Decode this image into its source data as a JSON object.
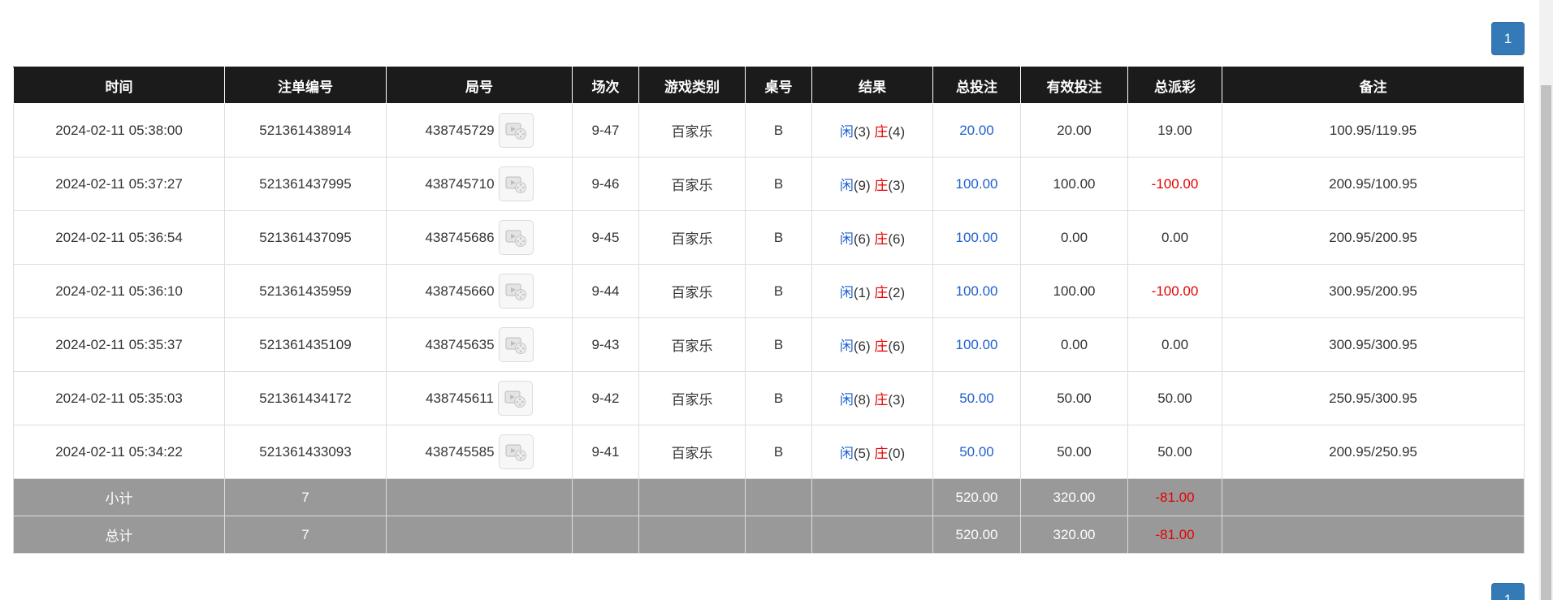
{
  "pagination": {
    "current_page": "1"
  },
  "table": {
    "headers": [
      "时间",
      "注单编号",
      "局号",
      "场次",
      "游戏类别",
      "桌号",
      "结果",
      "总投注",
      "有效投注",
      "总派彩",
      "备注"
    ],
    "rows": [
      {
        "time": "2024-02-11 05:38:00",
        "bet_id": "521361438914",
        "round": "438745729",
        "session": "9-47",
        "game": "百家乐",
        "table": "B",
        "result": {
          "player_label": "闲",
          "player_score": "(3)",
          "banker_label": "庄",
          "banker_score": "(4)"
        },
        "total_bet": "20.00",
        "valid_bet": "20.00",
        "payout": "19.00",
        "payout_negative": false,
        "note": "100.95/119.95"
      },
      {
        "time": "2024-02-11 05:37:27",
        "bet_id": "521361437995",
        "round": "438745710",
        "session": "9-46",
        "game": "百家乐",
        "table": "B",
        "result": {
          "player_label": "闲",
          "player_score": "(9)",
          "banker_label": "庄",
          "banker_score": "(3)"
        },
        "total_bet": "100.00",
        "valid_bet": "100.00",
        "payout": "-100.00",
        "payout_negative": true,
        "note": "200.95/100.95"
      },
      {
        "time": "2024-02-11 05:36:54",
        "bet_id": "521361437095",
        "round": "438745686",
        "session": "9-45",
        "game": "百家乐",
        "table": "B",
        "result": {
          "player_label": "闲",
          "player_score": "(6)",
          "banker_label": "庄",
          "banker_score": "(6)"
        },
        "total_bet": "100.00",
        "valid_bet": "0.00",
        "payout": "0.00",
        "payout_negative": false,
        "note": "200.95/200.95"
      },
      {
        "time": "2024-02-11 05:36:10",
        "bet_id": "521361435959",
        "round": "438745660",
        "session": "9-44",
        "game": "百家乐",
        "table": "B",
        "result": {
          "player_label": "闲",
          "player_score": "(1)",
          "banker_label": "庄",
          "banker_score": "(2)"
        },
        "total_bet": "100.00",
        "valid_bet": "100.00",
        "payout": "-100.00",
        "payout_negative": true,
        "note": "300.95/200.95"
      },
      {
        "time": "2024-02-11 05:35:37",
        "bet_id": "521361435109",
        "round": "438745635",
        "session": "9-43",
        "game": "百家乐",
        "table": "B",
        "result": {
          "player_label": "闲",
          "player_score": "(6)",
          "banker_label": "庄",
          "banker_score": "(6)"
        },
        "total_bet": "100.00",
        "valid_bet": "0.00",
        "payout": "0.00",
        "payout_negative": false,
        "note": "300.95/300.95"
      },
      {
        "time": "2024-02-11 05:35:03",
        "bet_id": "521361434172",
        "round": "438745611",
        "session": "9-42",
        "game": "百家乐",
        "table": "B",
        "result": {
          "player_label": "闲",
          "player_score": "(8)",
          "banker_label": "庄",
          "banker_score": "(3)"
        },
        "total_bet": "50.00",
        "valid_bet": "50.00",
        "payout": "50.00",
        "payout_negative": false,
        "note": "250.95/300.95"
      },
      {
        "time": "2024-02-11 05:34:22",
        "bet_id": "521361433093",
        "round": "438745585",
        "session": "9-41",
        "game": "百家乐",
        "table": "B",
        "result": {
          "player_label": "闲",
          "player_score": "(5)",
          "banker_label": "庄",
          "banker_score": "(0)"
        },
        "total_bet": "50.00",
        "valid_bet": "50.00",
        "payout": "50.00",
        "payout_negative": false,
        "note": "200.95/250.95"
      }
    ],
    "subtotal": {
      "label": "小计",
      "count": "7",
      "total_bet": "520.00",
      "valid_bet": "320.00",
      "payout": "-81.00"
    },
    "total": {
      "label": "总计",
      "count": "7",
      "total_bet": "520.00",
      "valid_bet": "320.00",
      "payout": "-81.00"
    }
  },
  "colors": {
    "header_bg": "#1b1b1b",
    "footer_bg": "#999999",
    "accent_blue": "#1f5fd1",
    "negative_red": "#e60000",
    "pager_bg": "#337ab7"
  },
  "icons": {
    "replay": "video-replay-icon"
  }
}
